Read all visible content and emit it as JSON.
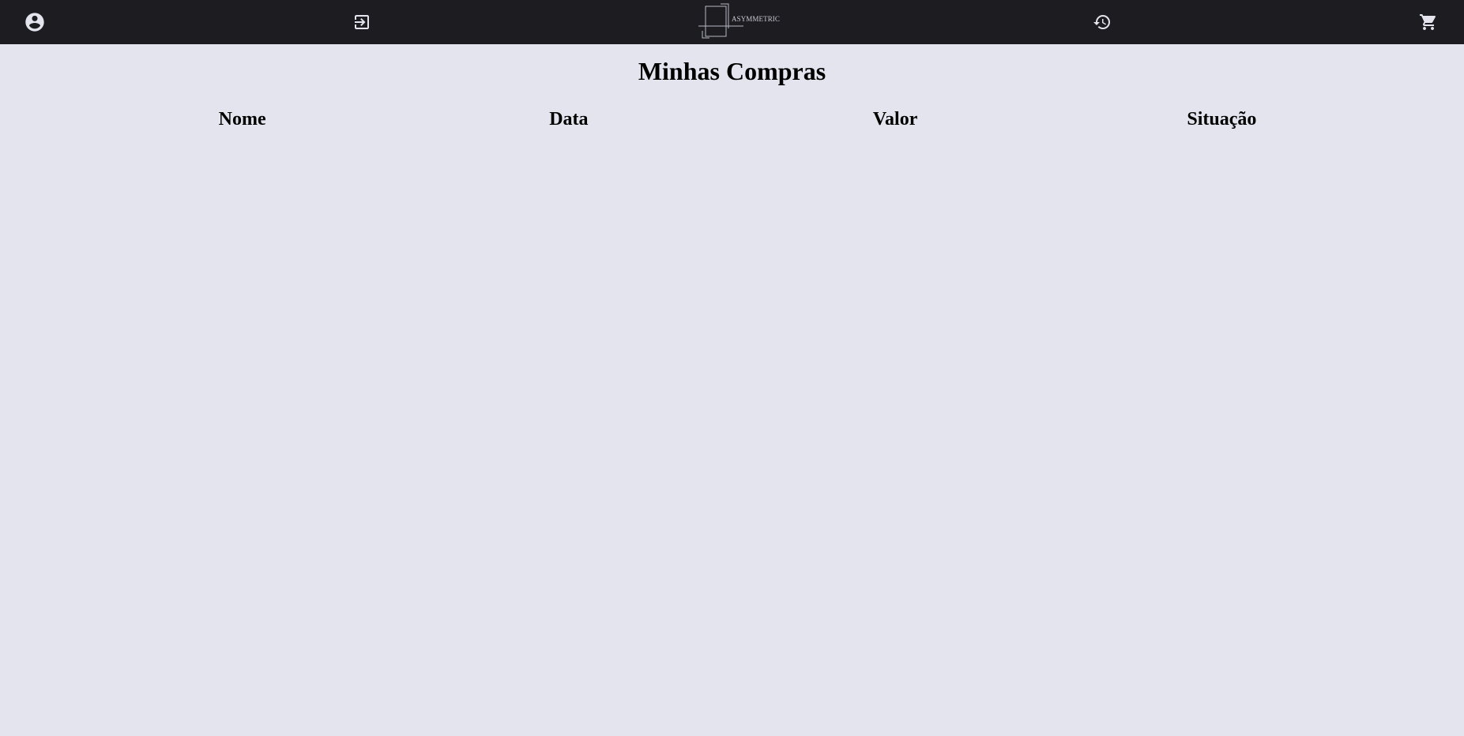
{
  "navbar": {
    "icons": {
      "profile": "account-circle-icon",
      "login": "login-icon",
      "history": "history-icon",
      "cart": "shopping-cart-icon"
    },
    "logo_text": "ASYMMETRIC",
    "icon_color": "#e4e4ee",
    "background": "#1d1c21"
  },
  "page": {
    "title": "Minhas Compras",
    "background": "#e4e4ee"
  },
  "table": {
    "columns": [
      "Nome",
      "Data",
      "Valor",
      "Situação"
    ],
    "rows": []
  }
}
